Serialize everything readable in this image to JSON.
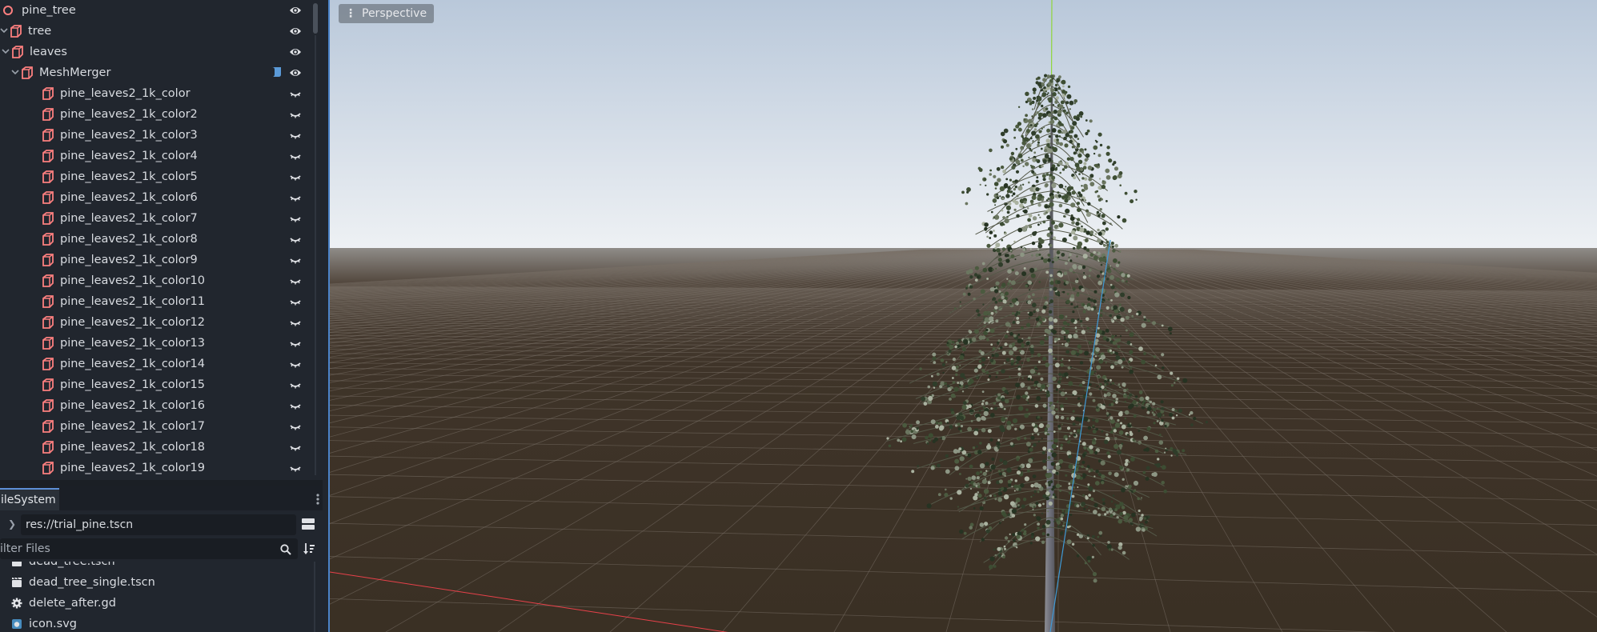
{
  "scene_tree": {
    "items": [
      {
        "label": "pine_tree",
        "depth": 0,
        "arrow": "",
        "icon": "root",
        "vis": "eye",
        "script": false
      },
      {
        "label": "tree",
        "depth": 0,
        "arrow": "v",
        "icon": "node3d",
        "vis": "eye",
        "script": false
      },
      {
        "label": "leaves",
        "depth": 1,
        "arrow": "v",
        "icon": "node3d",
        "vis": "eye",
        "script": false
      },
      {
        "label": "MeshMerger",
        "depth": 2,
        "arrow": "v",
        "icon": "node3d",
        "vis": "eye",
        "script": true
      },
      {
        "label": "pine_leaves2_1k_color",
        "depth": 3,
        "arrow": "",
        "icon": "node3d",
        "vis": "hidden",
        "script": false
      },
      {
        "label": "pine_leaves2_1k_color2",
        "depth": 3,
        "arrow": "",
        "icon": "node3d",
        "vis": "hidden",
        "script": false
      },
      {
        "label": "pine_leaves2_1k_color3",
        "depth": 3,
        "arrow": "",
        "icon": "node3d",
        "vis": "hidden",
        "script": false
      },
      {
        "label": "pine_leaves2_1k_color4",
        "depth": 3,
        "arrow": "",
        "icon": "node3d",
        "vis": "hidden",
        "script": false
      },
      {
        "label": "pine_leaves2_1k_color5",
        "depth": 3,
        "arrow": "",
        "icon": "node3d",
        "vis": "hidden",
        "script": false
      },
      {
        "label": "pine_leaves2_1k_color6",
        "depth": 3,
        "arrow": "",
        "icon": "node3d",
        "vis": "hidden",
        "script": false
      },
      {
        "label": "pine_leaves2_1k_color7",
        "depth": 3,
        "arrow": "",
        "icon": "node3d",
        "vis": "hidden",
        "script": false
      },
      {
        "label": "pine_leaves2_1k_color8",
        "depth": 3,
        "arrow": "",
        "icon": "node3d",
        "vis": "hidden",
        "script": false
      },
      {
        "label": "pine_leaves2_1k_color9",
        "depth": 3,
        "arrow": "",
        "icon": "node3d",
        "vis": "hidden",
        "script": false
      },
      {
        "label": "pine_leaves2_1k_color10",
        "depth": 3,
        "arrow": "",
        "icon": "node3d",
        "vis": "hidden",
        "script": false
      },
      {
        "label": "pine_leaves2_1k_color11",
        "depth": 3,
        "arrow": "",
        "icon": "node3d",
        "vis": "hidden",
        "script": false
      },
      {
        "label": "pine_leaves2_1k_color12",
        "depth": 3,
        "arrow": "",
        "icon": "node3d",
        "vis": "hidden",
        "script": false
      },
      {
        "label": "pine_leaves2_1k_color13",
        "depth": 3,
        "arrow": "",
        "icon": "node3d",
        "vis": "hidden",
        "script": false
      },
      {
        "label": "pine_leaves2_1k_color14",
        "depth": 3,
        "arrow": "",
        "icon": "node3d",
        "vis": "hidden",
        "script": false
      },
      {
        "label": "pine_leaves2_1k_color15",
        "depth": 3,
        "arrow": "",
        "icon": "node3d",
        "vis": "hidden",
        "script": false
      },
      {
        "label": "pine_leaves2_1k_color16",
        "depth": 3,
        "arrow": "",
        "icon": "node3d",
        "vis": "hidden",
        "script": false
      },
      {
        "label": "pine_leaves2_1k_color17",
        "depth": 3,
        "arrow": "",
        "icon": "node3d",
        "vis": "hidden",
        "script": false
      },
      {
        "label": "pine_leaves2_1k_color18",
        "depth": 3,
        "arrow": "",
        "icon": "node3d",
        "vis": "hidden",
        "script": false
      },
      {
        "label": "pine_leaves2_1k_color19",
        "depth": 3,
        "arrow": "",
        "icon": "node3d",
        "vis": "hidden",
        "script": false
      }
    ]
  },
  "filesystem": {
    "tab_label": "ileSystem",
    "path": "res://trial_pine.tscn",
    "filter_placeholder": "ilter Files",
    "files": [
      {
        "name": "dead_tree.tscn",
        "icon": "scene-icon"
      },
      {
        "name": "dead_tree_single.tscn",
        "icon": "scene-icon"
      },
      {
        "name": "delete_after.gd",
        "icon": "gear-icon"
      },
      {
        "name": "icon.svg",
        "icon": "image-icon"
      }
    ]
  },
  "viewport": {
    "perspective_label": "Perspective"
  },
  "colors": {
    "accent": "#4b83c9",
    "node_icon": "#fc7f7f",
    "eye": "#e0e2e6",
    "panel_bg": "#21262e",
    "x_axis": "#e8414a",
    "y_axis": "#8fd63a",
    "z_axis": "#3f9ad6",
    "floor": "#3b3128",
    "sky_top": "#b9c8da",
    "sky_bottom": "#eef1f4"
  }
}
